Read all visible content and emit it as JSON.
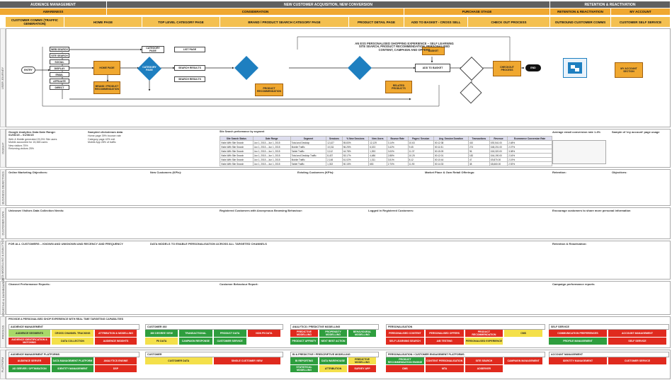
{
  "headers": {
    "audience": "AUDIENCE MANAGEMENT",
    "acquisition": "NEW CUSTOMER ACQUISITION, NEW CONVERSION",
    "retention": "RETENTION & REACTIVATION"
  },
  "subheaders": {
    "awareness": "AWARENESS",
    "consideration": "CONSIDERATION",
    "purchase": "PURCHASE STAGE",
    "retention": "RETENTION & REACTIVATION",
    "account": "MY ACCOUNT"
  },
  "stages": [
    "CUSTOMER COMMS (TRAFFIC GENERATION)",
    "HOME PAGE",
    "TOP LEVEL CATEGORY PAGE",
    "BRAND / PRODUCT SEARCH CATEGORY PAGE",
    "PRODUCT DETAIL PAGE",
    "ADD TO BASKET - CROSS SELL",
    "CHECK OUT PROCESS",
    "OUTBOUND CUSTOMER COMMS",
    "CUSTOMER SELF SERVICE"
  ],
  "side_labels": [
    "USER JOURNEY",
    "INSIGHT",
    "BUSINESS OBJECTIVES",
    "CUSTOMER DATA",
    "DATA MODELLING & ANALYTICS",
    "REPORTING & DASHBOARDS",
    "PROCESS",
    "PLATFORM"
  ],
  "journey": {
    "channels": [
      "WEB SEARCH",
      "SITE SEARCH",
      "SOCIAL",
      "DISPLAY",
      "EMAIL",
      "AFFILIATE",
      "DIRECT"
    ],
    "start": "ENTRY",
    "home": "HOME PAGE",
    "brand_rec": "BRAND / PRODUCT RECOMMENDATION",
    "cat_page": "CATEGORY PAGE",
    "list_page": "LIST PAGE",
    "search_results": "SEARCH RESULTS",
    "product_rec": "PRODUCT RECOMMENDATION",
    "pdp": "PRODUCT DETAIL PAGE",
    "related": "RELATED PRODUCTS",
    "add_basket": "ADD TO BASKET",
    "basket": "BASKET",
    "checkout": "CHECKOUT PROCESS",
    "cross_sell": "CROSS SELL",
    "end": "END",
    "ss_label": "AN ESS PERSONALISED SHOPPING EXPERIENCE – SELF LEARNING SITE SEARCH, PRODUCT RECOMMENDATION, PERSONALISED CONTENT, CAMPAIGN AND OFFERS",
    "my_account": "MY ACCOUNT SECTION"
  },
  "insight": {
    "ga_title": "Google Analytics Data Date Range: 01/06/15 – 01/06/15",
    "ga_lines": [
      "Web & Mobile generated 29,291 Site users",
      "Mobile accounted for 15,365 users",
      "New visitors 75%",
      "Returning visitors 25%"
    ],
    "sample_title": "Sampled clickstream data",
    "sample_lines": [
      "Home page 39% bounce rate",
      "Category page 42% exit",
      "Mobile App 28% of traffic"
    ],
    "table_caption": "Site Search performance by segment",
    "table_head": [
      "Site Search Status",
      "Date Range",
      "Segment",
      "Sessions",
      "% New Sessions",
      "New Users",
      "Bounce Rate",
      "Pages / Session",
      "Avg. Session Duration",
      "Transactions",
      "Revenue",
      "Ecommerce Conversion Rate"
    ],
    "table_rows": [
      [
        "Visits With Site Search",
        "Jun 1, 2015 – Jun 1, 2015",
        "Total and Desktop",
        "12,427",
        "55.83%",
        "12,129",
        "3.14%",
        "10.63",
        "00:12:38",
        "410",
        "£92,541.00",
        "2.48%"
      ],
      [
        "Visits With Site Search",
        "Jun 1, 2015 – Jun 1, 2015",
        "Mobile Traffic",
        "10,311",
        "56.25%",
        "6,023",
        "3.42%",
        "9.45",
        "00:11:51",
        "274",
        "£48,201.00",
        "2.07%"
      ],
      [
        "Visits With Site Search",
        "Jun 1, 2015 – Jun 1, 2015",
        "Tablet Traffic",
        "3,112",
        "44.78%",
        "1,393",
        "3.00%",
        "11.37",
        "00:15:09",
        "96",
        "£18,320.00",
        "3.08%"
      ],
      [
        "Visits With Site Search",
        "Jun 1, 2015 – Jun 1, 2015",
        "Total and Desktop Traffic",
        "8,437",
        "53.17%",
        "4,486",
        "2.88%",
        "10.25",
        "00:12:01",
        "182",
        "£44,190.00",
        "2.16%"
      ],
      [
        "Visits With Site Search",
        "Jun 1, 2015 – Jun 1, 2015",
        "Mobile Traffic",
        "2,148",
        "61.02%",
        "1,311",
        "3.51%",
        "8.12",
        "00:10:44",
        "47",
        "£9,870.00",
        "2.19%"
      ],
      [
        "Visits With Site Search",
        "Jun 1, 2015 – Jun 1, 2015",
        "Tablet Traffic",
        "1,302",
        "50.15%",
        "653",
        "2.70%",
        "11.90",
        "00:14:33",
        "38",
        "£8,660.00",
        "2.92%"
      ]
    ],
    "avg_order": "Average email conversion rate 1.4%",
    "account_note": "Sample of 'my account' page usage"
  },
  "objectives": {
    "online": "Online Marketing Objectives:",
    "new_cust": "New Customers (KPIs):",
    "existing": "Existing Customers (KPIs):",
    "market": "Market Place & Own Retail Offerings:",
    "retention": "Retention:",
    "objectives": "Objectives:"
  },
  "data": {
    "unknown": "Unknown Visitors Data Collection Needs:",
    "registered": "Registered Customers with Anonymous Browsing Behaviour:",
    "logged": "Logged in Registered Customers:",
    "retention": "Encourage customers to share more personal information"
  },
  "modelling": {
    "known": "FOR ALL CUSTOMERS – KNOWN AND UNKNOWN AND RECENCY AND FREQUENCY",
    "models": "DATA MODELS TO ENABLE PERSONALISATION ACROSS ALL TARGETED CHANNELS",
    "retention": "Retention & Reactivation:"
  },
  "reporting": {
    "channel": "Channel Performance Reports:",
    "behaviour": "Customer Behaviour Report:",
    "campaign": "Campaign performance reports"
  },
  "process": {
    "title": "PROVIDE A PERSONALISED SHOP EXPERIENCE WITH REAL TIME TARGETING CAPABILITIES",
    "groups": [
      {
        "name": "AUDIENCE MANAGEMENT",
        "items": [
          [
            "AUDIENCE SEGMENTS",
            "lgr"
          ],
          [
            "CROSS CHANNEL TRACKING",
            "yel"
          ],
          [
            "ATTRIBUTION & MODELLING",
            "red"
          ],
          [
            "AUDIENCE IDENTIFICATION & MATCHING",
            "red"
          ],
          [
            "DATA COLLECTION",
            "yel"
          ],
          [
            "AUDIENCE INSIGHTS",
            "red"
          ]
        ]
      },
      {
        "name": "CUSTOMER 360",
        "items": [
          [
            "360 DEGREE VIEW",
            "green"
          ],
          [
            "TRANSACTIONAL",
            "green"
          ],
          [
            "PRODUCT DATA",
            "green"
          ],
          [
            "NON PII DATA",
            "red"
          ],
          [
            "PII DATA",
            "yel"
          ],
          [
            "CAMPAIGN RESPONSE",
            "green"
          ],
          [
            "CUSTOMER SERVICE",
            "green"
          ]
        ]
      },
      {
        "name": "ANALYTICS / PREDICTIVE MODELLING",
        "items": [
          [
            "PREDICTIVE MODELLING",
            "red"
          ],
          [
            "PROPENSITY MODELLING",
            "green"
          ],
          [
            "BEHAVIOURAL MODELLING",
            "green"
          ],
          [
            "PRODUCT AFFINITY",
            "green"
          ],
          [
            "NEXT BEST ACTION",
            "green"
          ]
        ]
      },
      {
        "name": "PERSONALISATION",
        "items": [
          [
            "PERSONALISED CONTENT",
            "red"
          ],
          [
            "PERSONALISED OFFERS",
            "red"
          ],
          [
            "PRODUCT RECOMMENDATION",
            "red"
          ],
          [
            "CMS",
            "yel"
          ],
          [
            "SELF LEARNING SEARCH",
            "red"
          ],
          [
            "A/B TESTING",
            "red"
          ],
          [
            "PERSONALISED EXPERIENCE",
            "yel"
          ]
        ]
      },
      {
        "name": "SELF SERVICE",
        "items": [
          [
            "COMMUNICATION PREFERENCES",
            "red"
          ],
          [
            "ACCOUNT MANAGEMENT",
            "red"
          ],
          [
            "PROFILE MANAGEMENT",
            "green"
          ],
          [
            "SELF SERVICE",
            "red"
          ]
        ]
      }
    ]
  },
  "platform": {
    "groups": [
      {
        "name": "AUDIENCE MANAGEMENT PLATFORMS",
        "items": [
          [
            "AUDIENCE SERVER",
            "red"
          ],
          [
            "DATA MANAGEMENT PLATFORM",
            "green"
          ],
          [
            "ANALYTICS ENGINE",
            "red"
          ],
          [
            "AD SERVER / OPTIMISATION",
            "green"
          ],
          [
            "IDENTITY MANAGEMENT",
            "green"
          ],
          [
            "DSP",
            "red"
          ]
        ]
      },
      {
        "name": "CUSTOMER",
        "items": [
          [
            "CUSTOMER DATA",
            "yel"
          ],
          [
            "SINGLE CUSTOMER VIEW",
            "red"
          ]
        ]
      },
      {
        "name": "BI & PREDICTIVE / PRESCRIPTIVE MODELLING",
        "items": [
          [
            "BI REPORTING",
            "green"
          ],
          [
            "DATA WAREHOUSE",
            "green"
          ],
          [
            "PREDICTIVE MODELLING",
            "yel"
          ],
          [
            "STATISTICAL MODELLING",
            "green"
          ],
          [
            "ATTRIBUTION",
            "yel"
          ],
          [
            "SURVEY APP",
            "red"
          ]
        ]
      },
      {
        "name": "PERSONALISATION / CUSTOMER ENGAGEMENT PLATFORMS",
        "items": [
          [
            "PRODUCT RECOMMENDATION ENGINE",
            "green"
          ],
          [
            "CONTENT PERSONALISATION",
            "red"
          ],
          [
            "SITE SEARCH",
            "red"
          ],
          [
            "CAMPAIGN MANAGEMENT",
            "red"
          ],
          [
            "CMS",
            "red"
          ],
          [
            "MTA",
            "red"
          ],
          [
            "ADSERVER",
            "red"
          ]
        ]
      },
      {
        "name": "ACCOUNT MANAGEMENT",
        "items": [
          [
            "IDENTITY MANAGEMENT",
            "red"
          ],
          [
            "CUSTOMER SERVICE",
            "red"
          ]
        ]
      }
    ]
  }
}
